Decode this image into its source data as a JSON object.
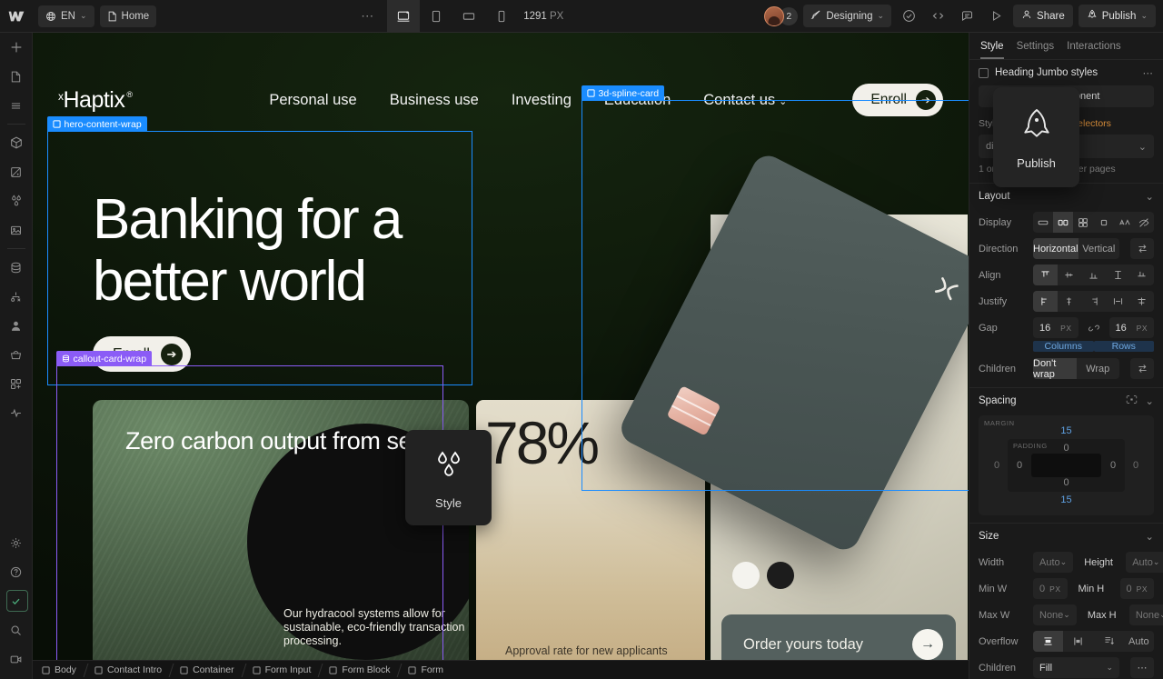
{
  "topbar": {
    "logo_icon": "webflow-logo-icon",
    "locale": {
      "icon": "globe-icon",
      "label": "EN",
      "caret": "⌄"
    },
    "page": {
      "icon": "page-icon",
      "label": "Home"
    },
    "overflow": "⋯",
    "breakpoints": [
      {
        "name": "desktop",
        "icon": "desktop-icon",
        "active": true
      },
      {
        "name": "tablet",
        "icon": "tablet-icon",
        "active": false
      },
      {
        "name": "mobile-landscape",
        "icon": "mobile-landscape-icon",
        "active": false
      },
      {
        "name": "mobile-portrait",
        "icon": "mobile-portrait-icon",
        "active": false
      }
    ],
    "viewport_width": "1291",
    "viewport_unit": "PX",
    "collaborators_count": "2",
    "mode": {
      "icon": "brush-icon",
      "label": "Designing",
      "caret": "⌄"
    },
    "icon_buttons": [
      "audit-check-icon",
      "code-icon",
      "comment-icon",
      "preview-play-icon"
    ],
    "share": {
      "icon": "person-icon",
      "label": "Share"
    },
    "publish": {
      "icon": "rocket-icon",
      "label": "Publish",
      "caret": "⌄"
    }
  },
  "left_rail": {
    "items": [
      {
        "name": "add-elements",
        "icon": "plus-icon"
      },
      {
        "name": "pages",
        "icon": "page-icon"
      },
      {
        "name": "navigator",
        "icon": "layers-icon"
      },
      {
        "name": "components",
        "icon": "cube-icon"
      },
      {
        "name": "variables",
        "icon": "variables-icon"
      },
      {
        "name": "style-sources",
        "icon": "droplets-icon"
      },
      {
        "name": "assets",
        "icon": "image-icon"
      },
      {
        "name": "cms",
        "icon": "database-icon"
      },
      {
        "name": "logic",
        "icon": "logic-icon"
      },
      {
        "name": "users",
        "icon": "user-icon"
      },
      {
        "name": "ecommerce",
        "icon": "basket-icon"
      },
      {
        "name": "apps",
        "icon": "apps-icon"
      },
      {
        "name": "analyze",
        "icon": "pulse-icon"
      }
    ],
    "bottom_items": [
      {
        "name": "settings",
        "icon": "gear-icon"
      },
      {
        "name": "help",
        "icon": "question-icon"
      },
      {
        "name": "audit",
        "icon": "checkbox-icon",
        "highlighted": true
      },
      {
        "name": "search",
        "icon": "search-icon"
      },
      {
        "name": "video",
        "icon": "video-icon"
      }
    ]
  },
  "canvas": {
    "site_nav": {
      "brand_sup": "x",
      "brand": "Haptix",
      "brand_reg": "®",
      "links": [
        "Personal use",
        "Business use",
        "Investing",
        "Education"
      ],
      "dropdown": {
        "label": "Contact us",
        "caret": "⌄"
      },
      "cta": {
        "label": "Enroll",
        "arrow": "➔"
      }
    },
    "hero": {
      "heading": "Banking for a better world",
      "cta": {
        "label": "Enroll",
        "arrow": "➔"
      }
    },
    "green_card": {
      "title": "Zero carbon output from servers",
      "body": "Our hydracool systems allow for sustainable, eco-friendly transaction processing."
    },
    "stat_card": {
      "value": "78%",
      "caption": "Approval rate for new applicants"
    },
    "product": {
      "card_logo": "haptix-x-logo-icon",
      "swatches": [
        "#f4f3ee",
        "#1c1c1c"
      ],
      "cta": {
        "label": "Order yours today",
        "arrow": "→"
      }
    },
    "overlays": {
      "hero_wrap_label": "hero-content-wrap",
      "callout_wrap_label": "callout-card-wrap",
      "spline_card_label": "3d-spline-card",
      "selection_blue": "#1a8cff",
      "selection_purple": "#8b5cf6"
    },
    "style_tooltip": {
      "icon": "droplets-icon",
      "label": "Style"
    }
  },
  "breadcrumb": {
    "items": [
      "Body",
      "Contact Intro",
      "Container",
      "Form Input",
      "Form Block",
      "Form"
    ]
  },
  "right_panel": {
    "tabs": [
      {
        "label": "Style",
        "active": true
      },
      {
        "label": "Settings",
        "active": false
      },
      {
        "label": "Interactions",
        "active": false
      }
    ],
    "selector": {
      "title": "Heading Jumbo styles",
      "overflow": "⋯",
      "component_button": "Component",
      "inheriting_prefix": "Styles are inheriting",
      "inheriting_count": "3 selectors",
      "selector_value": "div",
      "usage_note": "1 on this page, 4 on other pages"
    },
    "layout": {
      "title": "Layout",
      "display_label": "Display",
      "display_options": [
        "block-icon",
        "flex-icon",
        "grid-icon",
        "inline-block-icon",
        "inline-icon",
        "none-icon"
      ],
      "display_selected": "flex-icon",
      "direction_label": "Direction",
      "direction_options": [
        "Horizontal",
        "Vertical"
      ],
      "direction_selected": "Horizontal",
      "align_label": "Align",
      "justify_label": "Justify",
      "gap_label": "Gap",
      "gap_column": "16",
      "gap_row": "16",
      "gap_unit": "PX",
      "gap_sub_columns": "Columns",
      "gap_sub_rows": "Rows",
      "children_label": "Children",
      "children_options": [
        "Don't wrap",
        "Wrap"
      ],
      "children_selected": "Don't wrap"
    },
    "spacing": {
      "title": "Spacing",
      "margin_label": "MARGIN",
      "padding_label": "PADDING",
      "margin_top": "15",
      "margin_bottom": "15",
      "margin_left": "0",
      "margin_right": "0",
      "padding_top": "0",
      "padding_bottom": "0",
      "padding_left": "0",
      "padding_right": "0"
    },
    "size": {
      "title": "Size",
      "width_label": "Width",
      "width_value": "Auto",
      "height_label": "Height",
      "height_value": "Auto",
      "minw_label": "Min W",
      "minw_value": "0",
      "minh_label": "Min H",
      "minh_value": "0",
      "maxw_label": "Max W",
      "maxw_value": "None",
      "maxh_label": "Max H",
      "maxh_value": "None",
      "unit": "PX",
      "overflow_label": "Overflow",
      "overflow_options": [
        "visible-icon",
        "hidden-icon",
        "scroll-icon",
        "Auto"
      ],
      "children_label": "Children",
      "children_value": "Fill",
      "children_more": "⋯"
    }
  },
  "publish_tooltip": {
    "icon": "rocket-icon",
    "label": "Publish"
  }
}
